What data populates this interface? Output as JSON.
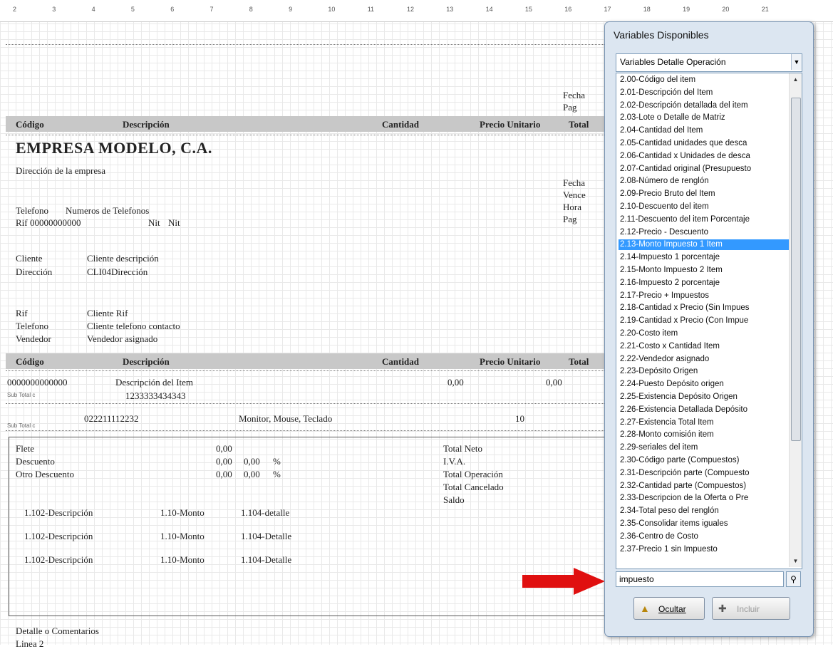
{
  "ruler_ticks": [
    "2",
    "3",
    "4",
    "5",
    "6",
    "7",
    "8",
    "9",
    "10",
    "11",
    "12",
    "13",
    "14",
    "15",
    "16",
    "17",
    "18",
    "19",
    "20",
    "21"
  ],
  "report": {
    "header_top": {
      "fecha": "Fecha",
      "pag": "Pag",
      "columns": [
        "Código",
        "Descripción",
        "Cantidad",
        "Precio Unitario",
        "Total"
      ]
    },
    "company": {
      "name": "EMPRESA MODELO, C.A.",
      "address": "Dirección de la empresa",
      "telefono_label": "Telefono",
      "telefono_value": "Numeros de Telefonos",
      "rif_label": "Rif",
      "rif_value": "00000000000",
      "nit_label": "Nit",
      "nit_value": "Nit",
      "right_labels": [
        "Fecha",
        "Vence",
        "Hora",
        "Pag"
      ]
    },
    "client": {
      "cliente_label": "Cliente",
      "cliente_value": "Cliente descripción",
      "direccion_label": "Dirección",
      "direccion_value": "CLI04Dirección",
      "rif_label": "Rif",
      "rif_value": "Cliente Rif",
      "telefono_label": "Telefono",
      "telefono_value": "Cliente telefono contacto",
      "vendedor_label": "Vendedor",
      "vendedor_value": "Vendedor asignado"
    },
    "detail_columns": [
      "Código",
      "Descripción",
      "Cantidad",
      "Precio Unitario",
      "Total"
    ],
    "detail_row": {
      "code": "0000000000000",
      "desc": "Descripción del Item",
      "qty": "0,00",
      "price": "0,00",
      "subtotal_label": "Sub Total c",
      "serial": "1233333434343"
    },
    "sub_row": {
      "label": "Sub Total c",
      "code": "022211112232",
      "desc": "Monitor, Mouse, Teclado",
      "qty": "10"
    },
    "totals": {
      "flete": "Flete",
      "descuento": "Descuento",
      "otro_descuento": "Otro Descuento",
      "v1": "0,00",
      "v2": "0,00",
      "v3": "0,00",
      "pct1": "0,00",
      "pct2": "0,00",
      "pct_sign": "%",
      "total_neto": "Total Neto",
      "iva": "I.V.A.",
      "total_operacion": "Total Operación",
      "total_cancelado": "Total Cancelado",
      "saldo": "Saldo",
      "pay_rows": [
        {
          "desc": "1.102-Descripción",
          "monto": "1.10-Monto",
          "detalle": "1.104-detalle"
        },
        {
          "desc": "1.102-Descripción",
          "monto": "1.10-Monto",
          "detalle": "1.104-Detalle"
        },
        {
          "desc": "1.102-Descripción",
          "monto": "1.10-Monto",
          "detalle": "1.104-Detalle"
        }
      ]
    },
    "footer": {
      "comments": "Detalle o Comentarios",
      "linea": "Linea 2"
    }
  },
  "panel": {
    "title": "Variables Disponibles",
    "combo_value": "Variables Detalle Operación",
    "items": [
      "2.00-Código del item",
      "2.01-Descripción del Item",
      "2.02-Descripción detallada del item",
      "2.03-Lote o Detalle de Matriz",
      "2.04-Cantidad del Item",
      "2.05-Cantidad unidades que desca",
      "2.06-Cantidad x Unidades de desca",
      "2.07-Cantidad original (Presupuesto",
      "2.08-Número de renglón",
      "2.09-Precio Bruto del Item",
      "2.10-Descuento del item",
      "2.11-Descuento del item Porcentaje",
      "2.12-Precio - Descuento",
      "2.13-Monto Impuesto 1 Item",
      "2.14-Impuesto 1 porcentaje",
      "2.15-Monto Impuesto 2 Item",
      "2.16-Impuesto 2 porcentaje",
      "2.17-Precio + Impuestos",
      "2.18-Cantidad x Precio (Sin Impues",
      "2.19-Cantidad x Precio (Con Impue",
      "2.20-Costo item",
      "2.21-Costo x Cantidad Item",
      "2.22-Vendedor asignado",
      "2.23-Depósito Origen",
      "2.24-Puesto Depósito origen",
      "2.25-Existencia Depósito Origen",
      "2.26-Existencia Detallada Depósito",
      "2.27-Existencia Total Item",
      "2.28-Monto comisión item",
      "2.29-seriales del item",
      "2.30-Código parte (Compuestos)",
      "2.31-Descripción parte (Compuesto",
      "2.32-Cantidad parte (Compuestos)",
      "2.33-Descripcion de la Oferta o Pre",
      "2.34-Total peso del renglón",
      "2.35-Consolidar items iguales",
      "2.36-Centro de Costo",
      "2.37-Precio 1 sin Impuesto"
    ],
    "selected_index": 13,
    "search_value": "impuesto",
    "ocultar_label": "Ocultar",
    "incluir_label": "Incluir"
  },
  "colors": {
    "selection": "#3399ff",
    "header_bar": "#c8c8c8",
    "arrow": "#e01010",
    "panel_bg": "#dce6f1"
  }
}
